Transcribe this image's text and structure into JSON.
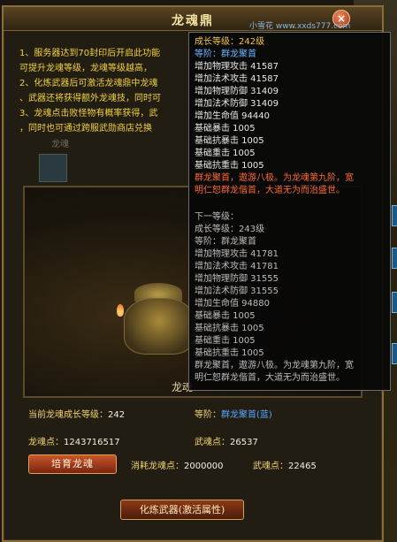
{
  "watermark": "小雪花 www.xxds777.com",
  "dialog": {
    "title": "龙魂鼎",
    "close_glyph": "×",
    "info_lines": [
      "1、服务器达到70封印后开启此功能",
      "可提升龙魂等级，龙魂等级越高，",
      "2、化炼武器后可激活龙魂鼎中龙魂",
      "、武器还将获得额外龙魂技，同时可",
      "3、龙魂点击败怪物有概率获得，武",
      "，同时也可通过跨服武勋商店兑换"
    ],
    "info_tag": "龙魂"
  },
  "scene": {
    "label": "龙魂"
  },
  "stats": {
    "growth_label": "当前龙魂成长等级：",
    "growth_value": "242",
    "rank_label": "等阶：",
    "rank_value": "群龙聚首(蓝)",
    "points_label": "龙魂点：",
    "points_value": "1243716517",
    "weapon_soul_label": "武魂点：",
    "weapon_soul_value": "26537",
    "consume_dragon_label": "消耗龙魂点：",
    "consume_dragon_value": "2000000",
    "consume_weapon_label": "武魂点：",
    "consume_weapon_value": "22465"
  },
  "buttons": {
    "cultivate": "培育龙魂",
    "refine": "化炼武器(激活属性)"
  },
  "tooltip": {
    "current": {
      "level": "成长等级：242级",
      "rank": "等阶：群龙聚首",
      "stats": [
        "增加物理攻击 41587",
        "增加法术攻击 41587",
        "增加物理防御 31409",
        "增加法术防御 31409",
        "增加生命值 94440",
        "基础暴击 1005",
        "基础抗暴击 1005",
        "基础重击 1005",
        "基础抗重击 1005"
      ],
      "desc_1": "群龙聚首，遨游八极。为龙魂第九阶，宽",
      "desc_2": "明仁恕群龙偕首，大道无为而治盛世。"
    },
    "next": {
      "header": "下一等级：",
      "level": "成长等级：243级",
      "rank": "等阶：群龙聚首",
      "stats": [
        "增加物理攻击 41781",
        "增加法术攻击 41781",
        "增加物理防御 31555",
        "增加法术防御 31555",
        "增加生命值 94880",
        "基础暴击 1005",
        "基础抗暴击 1005",
        "基础重击 1005",
        "基础抗重击 1005"
      ],
      "desc_1": "群龙聚首，遨游八极。为龙魂第九阶，宽",
      "desc_2": "明仁恕群龙偕首，大道无为而治盛世。"
    }
  }
}
